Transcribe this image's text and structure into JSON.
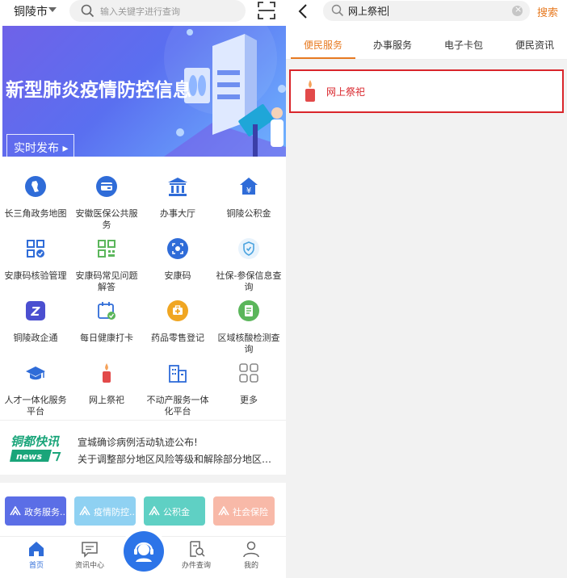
{
  "left": {
    "header": {
      "city": "铜陵市",
      "search_placeholder": "输入关键字进行查询"
    },
    "banner": {
      "title": "新型肺炎疫情防控信息",
      "button_label": "实时发布 ▸",
      "slide_count": 5,
      "active_slide": 3
    },
    "services": [
      {
        "label": "长三角政务地图",
        "icon": "map-icon",
        "color": "#2f6cd8"
      },
      {
        "label": "安徽医保公共服务",
        "icon": "medical-card-icon",
        "color": "#2f6cd8"
      },
      {
        "label": "办事大厅",
        "icon": "government-hall-icon",
        "color": "#2f6cd8"
      },
      {
        "label": "铜陵公积金",
        "icon": "housing-fund-icon",
        "color": "#2f6cd8"
      },
      {
        "label": "安康码核验管理",
        "icon": "qr-verify-icon",
        "color": "#2f6cd8"
      },
      {
        "label": "安康码常见问题解答",
        "icon": "qr-faq-icon",
        "color": "#5bb65b"
      },
      {
        "label": "安康码",
        "icon": "health-code-icon",
        "color": "#2f6cd8"
      },
      {
        "label": "社保-参保信息查询",
        "icon": "shield-icon",
        "color": "#4aa3df"
      },
      {
        "label": "铜陵政企通",
        "icon": "enterprise-icon",
        "color": "#4b4fd0"
      },
      {
        "label": "每日健康打卡",
        "icon": "calendar-check-icon",
        "color": "#2f6cd8"
      },
      {
        "label": "药品零售登记",
        "icon": "medicine-kit-icon",
        "color": "#f0a622"
      },
      {
        "label": "区域核酸检测查询",
        "icon": "test-report-icon",
        "color": "#5bb65b"
      },
      {
        "label": "人才一体化服务平台",
        "icon": "graduation-cap-icon",
        "color": "#2f6cd8"
      },
      {
        "label": "网上祭祀",
        "icon": "candle-icon",
        "color": "#e24a4a"
      },
      {
        "label": "不动产服务一体化平台",
        "icon": "building-icon",
        "color": "#2f6cd8"
      },
      {
        "label": "更多",
        "icon": "more-grid-icon",
        "color": "#888888"
      }
    ],
    "news": {
      "logo_top": "铜都快讯",
      "logo_bottom": "news",
      "items": [
        "宣城确诊病例活动轨迹公布!",
        "关于调整部分地区风险等级和解除部分地区管..."
      ]
    },
    "cards": [
      {
        "label": "政务服务...",
        "color": "#5b6ee6"
      },
      {
        "label": "疫情防控...",
        "color": "#8fd1f2"
      },
      {
        "label": "公积金",
        "color": "#5fd0c4"
      },
      {
        "label": "社会保险",
        "color": "#f8b9a8"
      }
    ],
    "tabbar": [
      {
        "label": "首页",
        "icon": "home-icon",
        "active": true
      },
      {
        "label": "资讯中心",
        "icon": "message-icon",
        "active": false
      },
      {
        "label": "办件查询",
        "icon": "search-doc-icon",
        "active": false
      },
      {
        "label": "我的",
        "icon": "user-icon",
        "active": false
      }
    ]
  },
  "right": {
    "search": {
      "value": "网上祭祀",
      "submit_label": "搜索"
    },
    "tabs": [
      "便民服务",
      "办事服务",
      "电子卡包",
      "便民资讯"
    ],
    "active_tab": "便民服务",
    "results": [
      {
        "label": "网上祭祀",
        "icon": "candle-icon"
      }
    ]
  },
  "colors": {
    "accent_orange": "#e77a21",
    "highlight_red": "#d9252b",
    "brand_blue": "#2f6cd8"
  }
}
